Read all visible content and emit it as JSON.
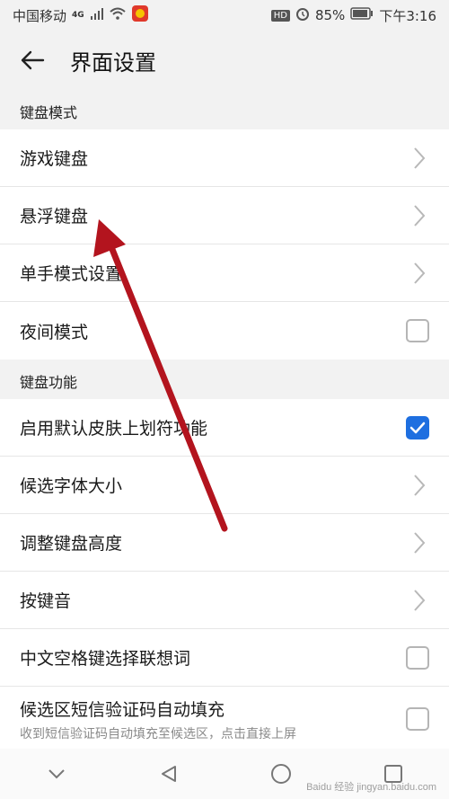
{
  "status": {
    "carrier": "中国移动",
    "network": "4G",
    "battery": "85%",
    "time": "下午3:16",
    "hd": "HD"
  },
  "header": {
    "title": "界面设置"
  },
  "sections": [
    {
      "title": "键盘模式",
      "items": [
        {
          "label": "游戏键盘",
          "control": "chevron"
        },
        {
          "label": "悬浮键盘",
          "control": "chevron"
        },
        {
          "label": "单手模式设置",
          "control": "chevron"
        },
        {
          "label": "夜间模式",
          "control": "checkbox",
          "checked": false
        }
      ]
    },
    {
      "title": "键盘功能",
      "items": [
        {
          "label": "启用默认皮肤上划符功能",
          "control": "checkbox",
          "checked": true
        },
        {
          "label": "候选字体大小",
          "control": "chevron"
        },
        {
          "label": "调整键盘高度",
          "control": "chevron"
        },
        {
          "label": "按键音",
          "control": "chevron"
        },
        {
          "label": "中文空格键选择联想词",
          "control": "checkbox",
          "checked": false
        },
        {
          "label": "候选区短信验证码自动填充",
          "sub": "收到短信验证码自动填充至候选区，点击直接上屏",
          "control": "checkbox",
          "checked": false
        }
      ]
    }
  ],
  "watermark": "Baidu 经验 jingyan.baidu.com",
  "colors": {
    "accent": "#1e6fe0",
    "annotation_arrow": "#b3141e"
  }
}
